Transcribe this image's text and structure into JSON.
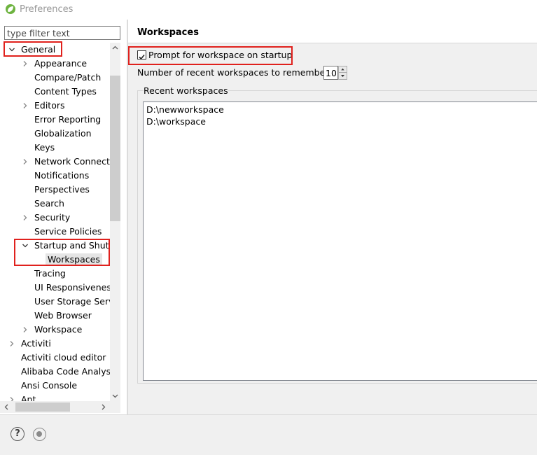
{
  "window": {
    "title": "Preferences"
  },
  "filter": {
    "placeholder": "type filter text"
  },
  "tree": [
    {
      "label": "General",
      "expander": "expanded"
    },
    {
      "label": "Appearance",
      "expander": "collapsed"
    },
    {
      "label": "Compare/Patch",
      "expander": "none"
    },
    {
      "label": "Content Types",
      "expander": "none"
    },
    {
      "label": "Editors",
      "expander": "collapsed"
    },
    {
      "label": "Error Reporting",
      "expander": "none"
    },
    {
      "label": "Globalization",
      "expander": "none"
    },
    {
      "label": "Keys",
      "expander": "none"
    },
    {
      "label": "Network Connections",
      "expander": "collapsed"
    },
    {
      "label": "Notifications",
      "expander": "none"
    },
    {
      "label": "Perspectives",
      "expander": "none"
    },
    {
      "label": "Search",
      "expander": "none"
    },
    {
      "label": "Security",
      "expander": "collapsed"
    },
    {
      "label": "Service Policies",
      "expander": "none"
    },
    {
      "label": "Startup and Shutdown",
      "expander": "expanded"
    },
    {
      "label": "Workspaces",
      "expander": "none",
      "selected": true
    },
    {
      "label": "Tracing",
      "expander": "none"
    },
    {
      "label": "UI Responsiveness Monitoring",
      "expander": "none"
    },
    {
      "label": "User Storage Service",
      "expander": "none"
    },
    {
      "label": "Web Browser",
      "expander": "none"
    },
    {
      "label": "Workspace",
      "expander": "collapsed"
    },
    {
      "label": "Activiti",
      "expander": "collapsed"
    },
    {
      "label": "Activiti cloud editor",
      "expander": "none"
    },
    {
      "label": "Alibaba Code Analysis",
      "expander": "none"
    },
    {
      "label": "Ansi Console",
      "expander": "none"
    },
    {
      "label": "Ant",
      "expander": "collapsed"
    }
  ],
  "page": {
    "title": "Workspaces",
    "prompt_checkbox": {
      "label": "Prompt for workspace on startup",
      "checked": true
    },
    "recent_count": {
      "label": "Number of recent workspaces to remember:",
      "value": "10"
    },
    "recent_group": {
      "title": "Recent workspaces",
      "items": [
        "D:\\newworkspace",
        "D:\\workspace"
      ]
    }
  },
  "bottom": {
    "help_icon": "question-icon",
    "oomph_icon": "record-icon"
  },
  "colors": {
    "highlight_box": "#e0211d",
    "selection": "#e5e5e5",
    "icon_green": "#6db33f"
  }
}
